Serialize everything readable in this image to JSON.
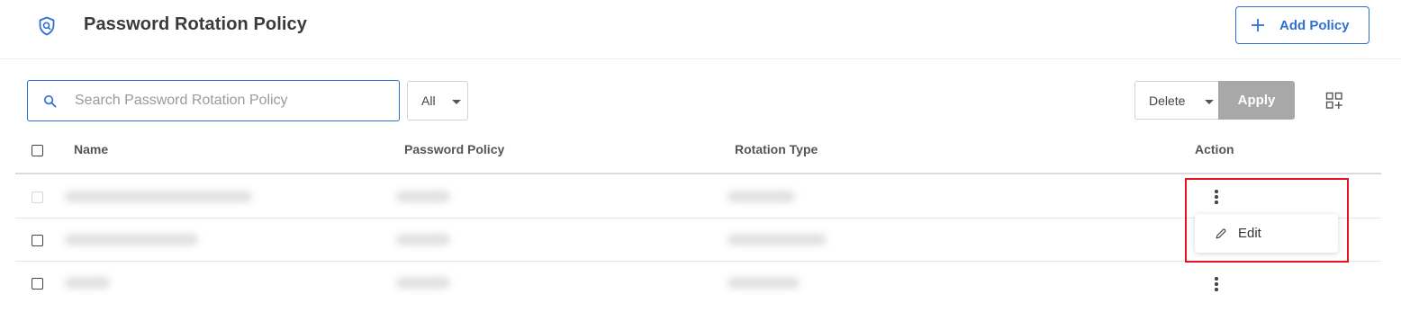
{
  "header": {
    "title": "Password Rotation Policy",
    "icon": "shield-search-icon",
    "add_button_label": "Add Policy"
  },
  "toolbar": {
    "search_placeholder": "Search Password Rotation Policy",
    "search_value": "",
    "filter_value": "All",
    "bulk_action_value": "Delete",
    "apply_label": "Apply"
  },
  "table": {
    "columns": [
      "Name",
      "Password Policy",
      "Rotation Type",
      "Action"
    ],
    "rows": [
      {
        "name": "",
        "password_policy": "",
        "rotation_type": "",
        "checkbox_disabled": true
      },
      {
        "name": "",
        "password_policy": "",
        "rotation_type": "",
        "checkbox_disabled": false
      },
      {
        "name": "",
        "password_policy": "",
        "rotation_type": "",
        "checkbox_disabled": false
      }
    ]
  },
  "action_menu": {
    "items": [
      {
        "label": "Edit",
        "icon": "pencil-icon"
      }
    ]
  },
  "colors": {
    "accent": "#2f6fd6",
    "apply_disabled": "#a8a8a8",
    "highlight": "#e1141f"
  }
}
